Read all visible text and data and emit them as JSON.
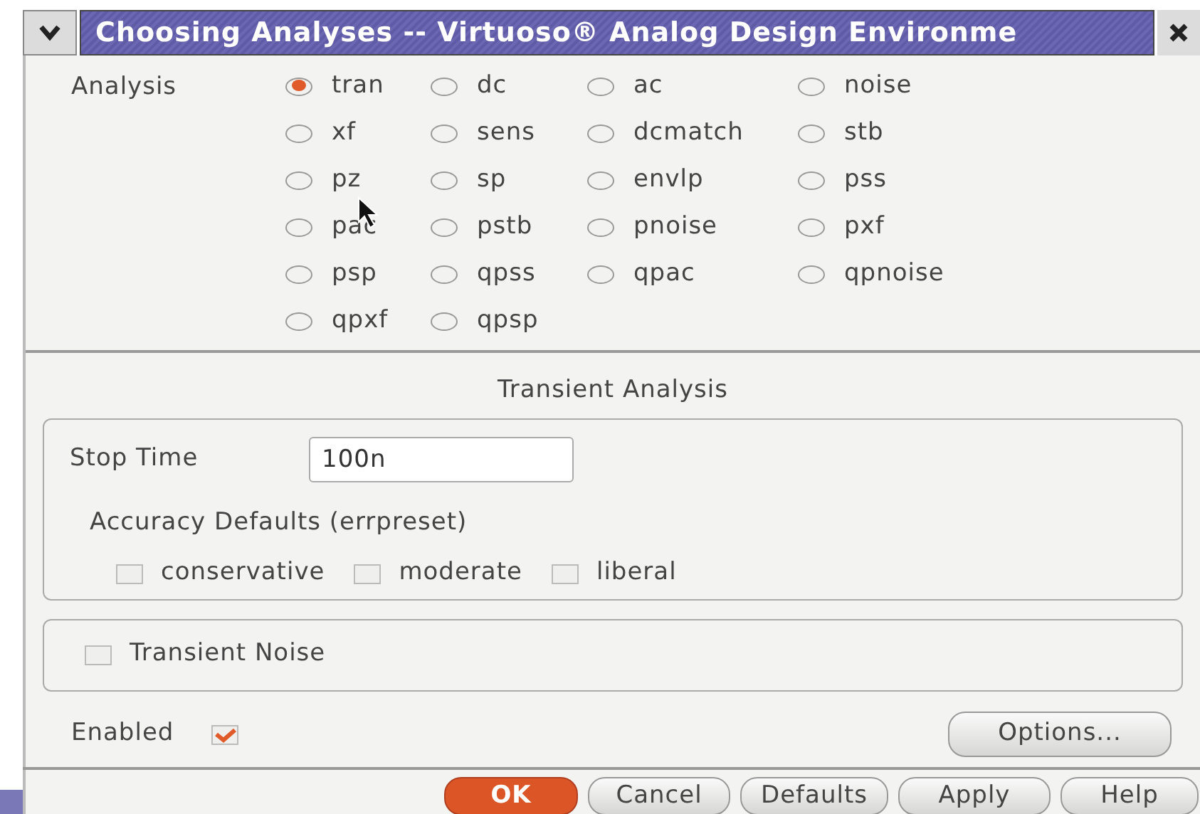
{
  "window": {
    "title": "Choosing Analyses -- Virtuoso® Analog Design Environme"
  },
  "analysis": {
    "label": "Analysis",
    "options": [
      {
        "label": "tran",
        "selected": true
      },
      {
        "label": "dc",
        "selected": false
      },
      {
        "label": "ac",
        "selected": false
      },
      {
        "label": "noise",
        "selected": false
      },
      {
        "label": "xf",
        "selected": false
      },
      {
        "label": "sens",
        "selected": false
      },
      {
        "label": "dcmatch",
        "selected": false
      },
      {
        "label": "stb",
        "selected": false
      },
      {
        "label": "pz",
        "selected": false
      },
      {
        "label": "sp",
        "selected": false
      },
      {
        "label": "envlp",
        "selected": false
      },
      {
        "label": "pss",
        "selected": false
      },
      {
        "label": "pac",
        "selected": false
      },
      {
        "label": "pstb",
        "selected": false
      },
      {
        "label": "pnoise",
        "selected": false
      },
      {
        "label": "pxf",
        "selected": false
      },
      {
        "label": "psp",
        "selected": false
      },
      {
        "label": "qpss",
        "selected": false
      },
      {
        "label": "qpac",
        "selected": false
      },
      {
        "label": "qpnoise",
        "selected": false
      },
      {
        "label": "qpxf",
        "selected": false
      },
      {
        "label": "qpsp",
        "selected": false
      }
    ]
  },
  "section_title": "Transient Analysis",
  "stop_time": {
    "label": "Stop Time",
    "value": "100n"
  },
  "accuracy": {
    "label": "Accuracy Defaults (errpreset)",
    "options": [
      {
        "label": "conservative",
        "checked": false
      },
      {
        "label": "moderate",
        "checked": false
      },
      {
        "label": "liberal",
        "checked": false
      }
    ]
  },
  "transient_noise": {
    "label": "Transient Noise",
    "checked": false
  },
  "enabled": {
    "label": "Enabled",
    "checked": true
  },
  "options_button": "Options...",
  "buttons": [
    {
      "label": "OK",
      "kind": "primary"
    },
    {
      "label": "Cancel",
      "kind": "normal"
    },
    {
      "label": "Defaults",
      "kind": "normal"
    },
    {
      "label": "Apply",
      "kind": "normal"
    },
    {
      "label": "Help",
      "kind": "normal"
    }
  ]
}
